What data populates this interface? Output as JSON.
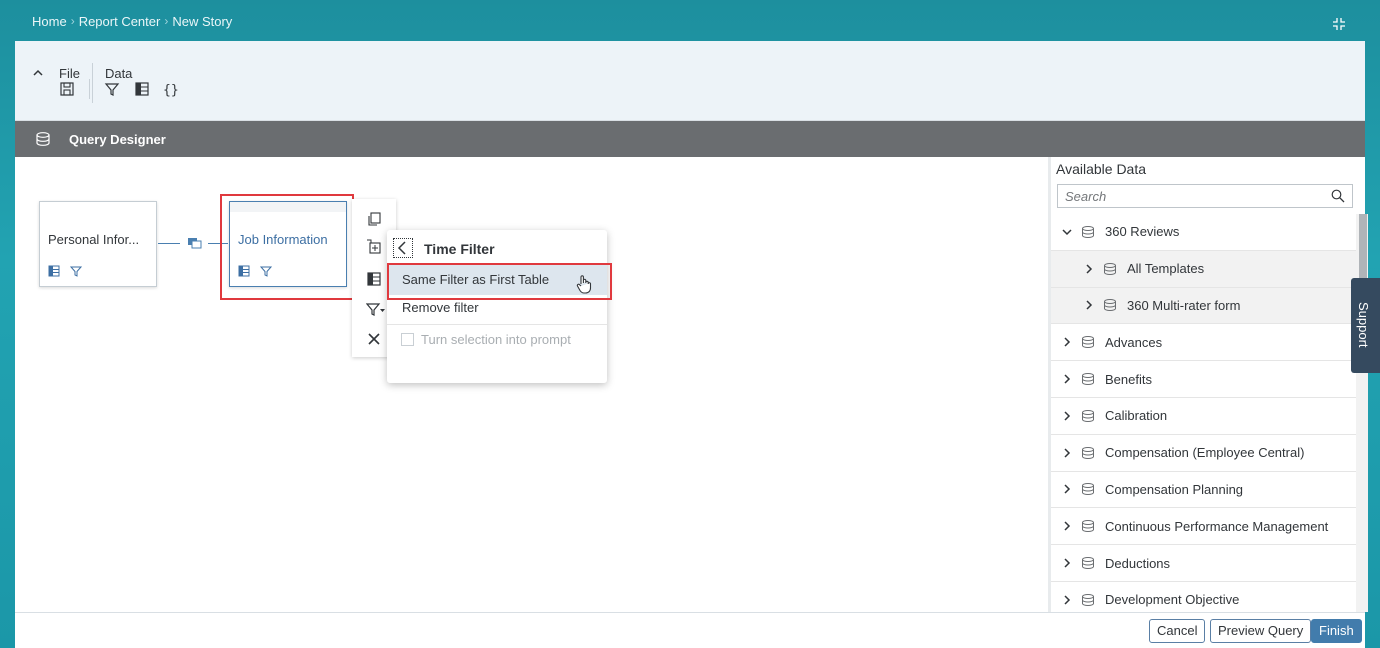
{
  "breadcrumb": [
    "Home",
    "Report Center",
    "New Story"
  ],
  "toolbar": {
    "file_label": "File",
    "data_label": "Data"
  },
  "query_designer": {
    "title": "Query Designer"
  },
  "canvas": {
    "tables": [
      {
        "name": "Personal Infor..."
      },
      {
        "name": "Job Information"
      }
    ]
  },
  "popover": {
    "title": "Time Filter",
    "items": [
      "Same Filter as First Table",
      "Remove filter"
    ],
    "checkbox_label": "Turn selection into prompt"
  },
  "available_data": {
    "title": "Available Data",
    "search_placeholder": "Search",
    "items": [
      {
        "label": "360 Reviews",
        "expanded": true,
        "level": 0
      },
      {
        "label": "All Templates",
        "level": 1
      },
      {
        "label": "360 Multi-rater form",
        "level": 1
      },
      {
        "label": "Advances",
        "level": 0
      },
      {
        "label": "Benefits",
        "level": 0
      },
      {
        "label": "Calibration",
        "level": 0
      },
      {
        "label": "Compensation (Employee Central)",
        "level": 0
      },
      {
        "label": "Compensation Planning",
        "level": 0
      },
      {
        "label": "Continuous Performance Management",
        "level": 0
      },
      {
        "label": "Deductions",
        "level": 0
      },
      {
        "label": "Development Objective",
        "level": 0
      }
    ]
  },
  "support_label": "Support",
  "footer": {
    "cancel": "Cancel",
    "preview": "Preview Query",
    "finish": "Finish"
  },
  "colors": {
    "accent": "#427cac",
    "highlight": "#e0393e",
    "header_bar": "#6a6d70",
    "support_tab": "#354a5f"
  }
}
